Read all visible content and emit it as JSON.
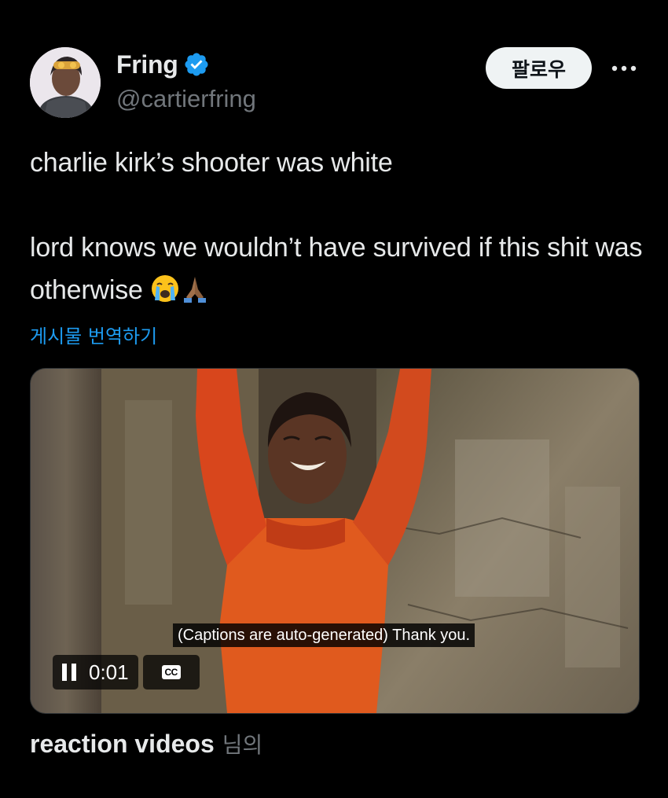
{
  "author": {
    "display_name": "Fring",
    "handle": "@cartierfring",
    "verified": true,
    "avatar_icon": "profile-avatar"
  },
  "header": {
    "follow_label": "팔로우",
    "more_icon": "more-dots-icon"
  },
  "tweet": {
    "line1": "charlie kirk’s shooter was white",
    "line2": "lord knows we wouldn’t have survived if this shit was otherwise",
    "emojis": [
      "loudly-crying-face",
      "folded-hands-medium-dark"
    ]
  },
  "translate_label": "게시물 번역하기",
  "media": {
    "caption": "(Captions are auto-generated) Thank you.",
    "time": "0:01",
    "cc_label": "CC",
    "playing": true
  },
  "attribution": {
    "user": "reaction videos",
    "suffix": "님의"
  },
  "colors": {
    "background": "#000000",
    "text": "#e7e9ea",
    "secondary": "#71767b",
    "link": "#1d9bf0",
    "verified": "#1d9bf0"
  }
}
